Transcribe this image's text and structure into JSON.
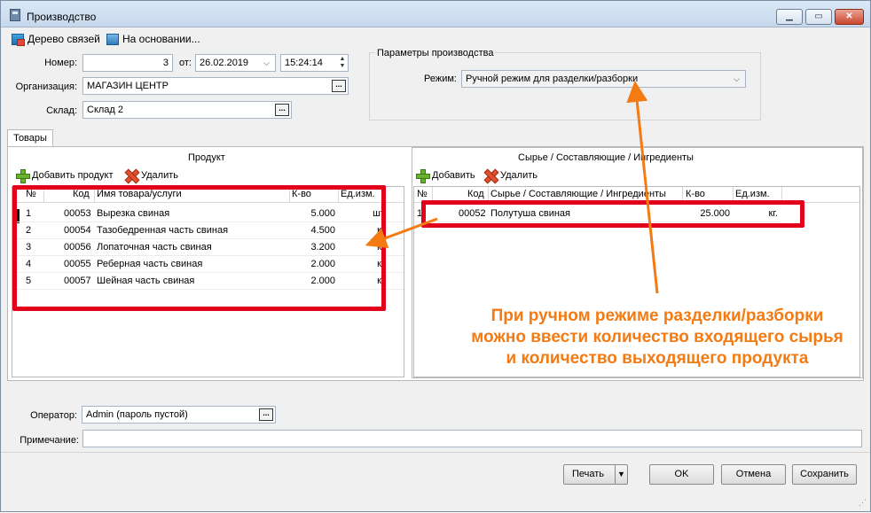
{
  "window": {
    "title": "Производство"
  },
  "toolbar": {
    "tree_label": "Дерево связей",
    "basis_label": "На основании..."
  },
  "form": {
    "number_label": "Номер:",
    "number_value": "3",
    "from_label": "от:",
    "date_value": "26.02.2019",
    "time_value": "15:24:14",
    "org_label": "Организация:",
    "org_value": "МАГАЗИН ЦЕНТР",
    "warehouse_label": "Склад:",
    "warehouse_value": "Склад 2",
    "params_group": "Параметры производства",
    "mode_label": "Режим:",
    "mode_value": "Ручной режим для разделки/разборки"
  },
  "tabs": [
    {
      "label": "Товары"
    }
  ],
  "product": {
    "title": "Продукт",
    "add_label": "Добавить продукт",
    "delete_label": "Удалить",
    "columns": [
      "№",
      "Код",
      "Имя товара/услуги",
      "К-во",
      "Ед.изм."
    ],
    "rows": [
      {
        "n": "1",
        "code": "00053",
        "name": "Вырезка свиная",
        "qty": "5.000",
        "unit": "шт"
      },
      {
        "n": "2",
        "code": "00054",
        "name": "Тазобедренная часть свиная",
        "qty": "4.500",
        "unit": "кг"
      },
      {
        "n": "3",
        "code": "00056",
        "name": "Лопаточная часть свиная",
        "qty": "3.200",
        "unit": "кг"
      },
      {
        "n": "4",
        "code": "00055",
        "name": "Реберная часть свиная",
        "qty": "2.000",
        "unit": "кг"
      },
      {
        "n": "5",
        "code": "00057",
        "name": "Шейная часть свиная",
        "qty": "2.000",
        "unit": "кг"
      }
    ]
  },
  "raw": {
    "title": "Сырье / Составляющие / Ингредиенты",
    "add_label": "Добавить",
    "delete_label": "Удалить",
    "columns": [
      "№",
      "Код",
      "Сырье / Составляющие / Ингредиенты",
      "К-во",
      "Ед.изм."
    ],
    "rows": [
      {
        "n": "1",
        "code": "00052",
        "name": "Полутуша свиная",
        "qty": "25.000",
        "unit": "кг."
      }
    ]
  },
  "callout": {
    "line1": "При ручном режиме разделки/разборки",
    "line2": "можно ввести количество входящего сырья",
    "line3": "и количество выходящего продукта",
    "color": "#f47a12"
  },
  "footer": {
    "operator_label": "Оператор:",
    "operator_value": "Admin (пароль пустой)",
    "note_label": "Примечание:",
    "note_value": "",
    "print_label": "Печать",
    "ok_label": "OK",
    "cancel_label": "Отмена",
    "save_label": "Сохранить"
  },
  "colors": {
    "highlight_red": "#e3001b",
    "arrow_orange": "#f47a12"
  }
}
